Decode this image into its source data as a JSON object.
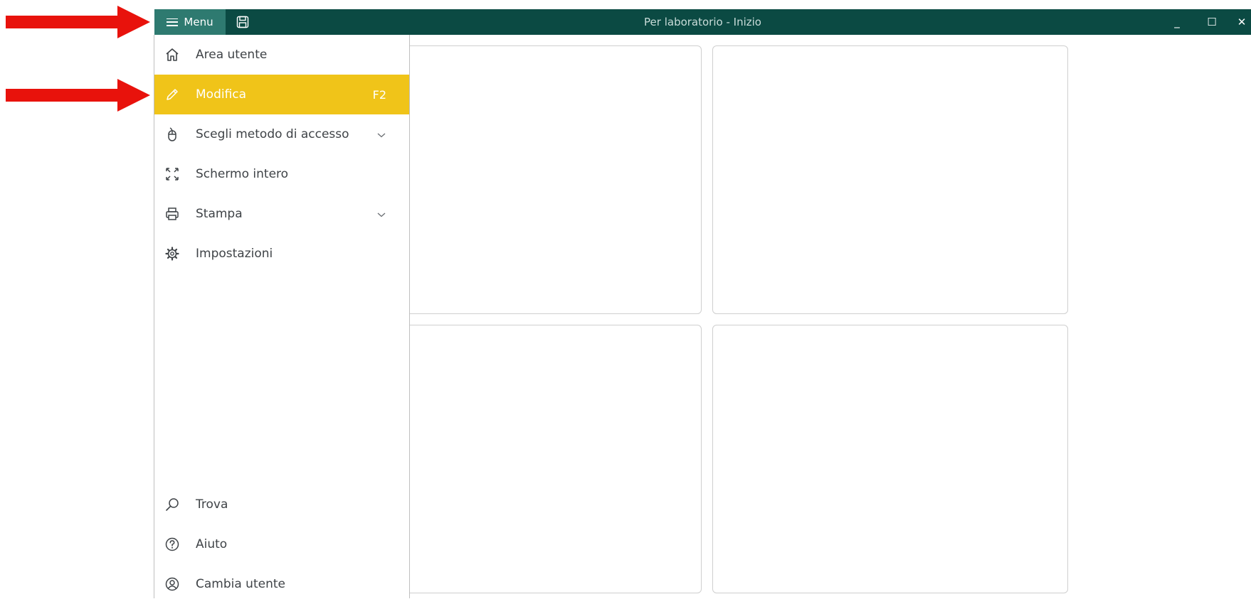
{
  "titlebar": {
    "menu_label": "Menu",
    "title": "Per laboratorio - Inizio",
    "minimize": "_",
    "maximize": "☐",
    "close": "✕"
  },
  "menu": {
    "items": [
      {
        "label": "Area utente",
        "icon": "home-icon"
      },
      {
        "label": "Modifica",
        "icon": "pencil-icon",
        "shortcut": "F2",
        "active": true
      },
      {
        "label": "Scegli metodo di accesso",
        "icon": "mouse-icon",
        "expandable": true
      },
      {
        "label": "Schermo intero",
        "icon": "fullscreen-icon"
      },
      {
        "label": "Stampa",
        "icon": "printer-icon",
        "expandable": true
      },
      {
        "label": "Impostazioni",
        "icon": "gear-icon"
      }
    ],
    "bottom_items": [
      {
        "label": "Trova",
        "icon": "search-icon"
      },
      {
        "label": "Aiuto",
        "icon": "help-icon"
      },
      {
        "label": "Cambia utente",
        "icon": "user-circle-icon"
      }
    ]
  },
  "colors": {
    "titlebar": "#0b4a43",
    "menu_button": "#2e7a70",
    "highlight": "#f0c419",
    "annotation_arrow": "#e8120c"
  }
}
